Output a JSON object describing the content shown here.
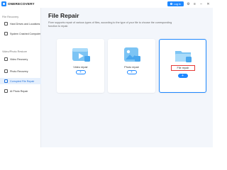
{
  "app": {
    "name": "ONERECOVERY",
    "login_label": "Log in"
  },
  "window_icons": [
    "settings-icon",
    "menu-icon",
    "minimize-icon",
    "close-icon"
  ],
  "sidebar": {
    "sections": [
      {
        "title": "File Recovery",
        "items": [
          {
            "label": "Hard Drives and Locations",
            "active": false
          },
          {
            "label": "System Crashed Computer",
            "active": false
          }
        ]
      },
      {
        "title": "Video/Photo Restore",
        "items": [
          {
            "label": "Video Recovery",
            "active": false
          },
          {
            "label": "Photo Recovery",
            "active": false
          },
          {
            "label": "Corrupted File Repair",
            "active": true
          },
          {
            "label": "AI Photo Repair",
            "active": false
          }
        ]
      }
    ]
  },
  "main": {
    "title": "File Repair",
    "description": "Fixer supports repair of various types of files, according to the type of your file to choose the corresponding function to repair.",
    "cards": [
      {
        "label": "Video repair",
        "button": "+",
        "icon": "video-file-icon",
        "selected": false
      },
      {
        "label": "Photo repair",
        "button": "+",
        "icon": "photo-file-icon",
        "selected": false
      },
      {
        "label": "File repair",
        "button": "+",
        "icon": "folder-icon",
        "selected": true
      }
    ]
  },
  "colors": {
    "accent": "#1e88ff",
    "highlight": "#e53935",
    "sidebar_active_bg": "#e6f0fd",
    "main_bg": "#f3f6fb"
  }
}
